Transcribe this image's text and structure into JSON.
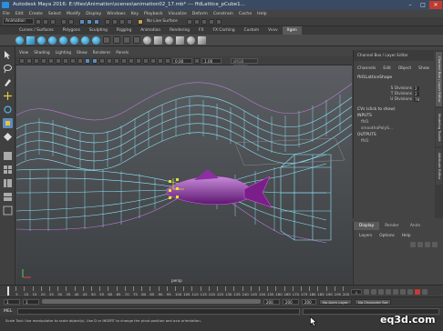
{
  "window": {
    "title": "Autodesk Maya 2016: E:\\files\\Animation\\scenes\\animation02_17.mb* --- ffdLattice_pCube1..."
  },
  "menubar": {
    "items": [
      "File",
      "Edit",
      "Create",
      "Select",
      "Modify",
      "Display",
      "Windows",
      "Key",
      "Playback",
      "Visualize",
      "Deform",
      "Constrain",
      "Cache",
      "Help"
    ]
  },
  "statusline": {
    "mode": "Animation",
    "live_surface": "No Live Surface"
  },
  "shelf": {
    "tabs": [
      "Curves / Surfaces",
      "Polygons",
      "Sculpting",
      "Rigging",
      "Animation",
      "Rendering",
      "FX",
      "FX Caching",
      "Custom",
      "Vvvv",
      "Xgen"
    ],
    "active_tab": "Xgen"
  },
  "panel": {
    "menu": [
      "View",
      "Shading",
      "Lighting",
      "Show",
      "Renderer",
      "Panels"
    ],
    "field_a": "0.00",
    "field_b": "1.00",
    "camera_select": "sRGB gamma",
    "camera_label": "persp"
  },
  "channel_box": {
    "header": "Channel Box / Layer Editor",
    "menu": [
      "Channels",
      "Edit",
      "Object",
      "Show"
    ],
    "node": "ffd1LatticeShape",
    "attributes": [
      {
        "label": "S Divisions",
        "value": "2"
      },
      {
        "label": "T Divisions",
        "value": "2"
      },
      {
        "label": "U Divisions",
        "value": "78"
      }
    ],
    "cvs_label": "CVs (click to show)",
    "inputs_label": "INPUTS",
    "inputs": [
      "ffd1",
      "smoothoPolyS..."
    ],
    "outputs_label": "OUTPUTS",
    "outputs": [
      "ffd1"
    ],
    "side_tabs": [
      "Channel Box / Layer Editor",
      "Modeling Toolkit",
      "Attribute Editor"
    ]
  },
  "layer_panel": {
    "tabs": [
      "Display",
      "Render",
      "Anim"
    ],
    "active_tab": "Display",
    "menu": [
      "Layers",
      "Options",
      "Help"
    ]
  },
  "time_slider": {
    "ticks": [
      "1",
      "5",
      "10",
      "15",
      "20",
      "25",
      "30",
      "35",
      "40",
      "45",
      "50",
      "55",
      "60",
      "65",
      "70",
      "75",
      "80",
      "85",
      "90",
      "95",
      "100",
      "105",
      "110",
      "115",
      "120",
      "125",
      "130",
      "135",
      "140",
      "145",
      "150",
      "155",
      "160",
      "165",
      "170",
      "175",
      "180",
      "185",
      "190",
      "195",
      "200"
    ],
    "current_frame": "1"
  },
  "range_slider": {
    "start": "1",
    "start_inner": "1",
    "end_inner": "200",
    "end": "200",
    "end_outer": "200",
    "anim_layer": "No Anim Layer",
    "character_set": "No Character Set"
  },
  "command_line": {
    "label": "MEL"
  },
  "help_line": {
    "text": "Scale Tool: Use manipulator to scale object(s). Use D or INSERT to change the pivot position and axis orientation."
  },
  "watermark": "eq3d.com",
  "colors": {
    "lattice": "#7fe3ff",
    "fish_body": "#7a1f8a",
    "highlight": "#e8e02c",
    "accent": "#5d8cc0"
  }
}
